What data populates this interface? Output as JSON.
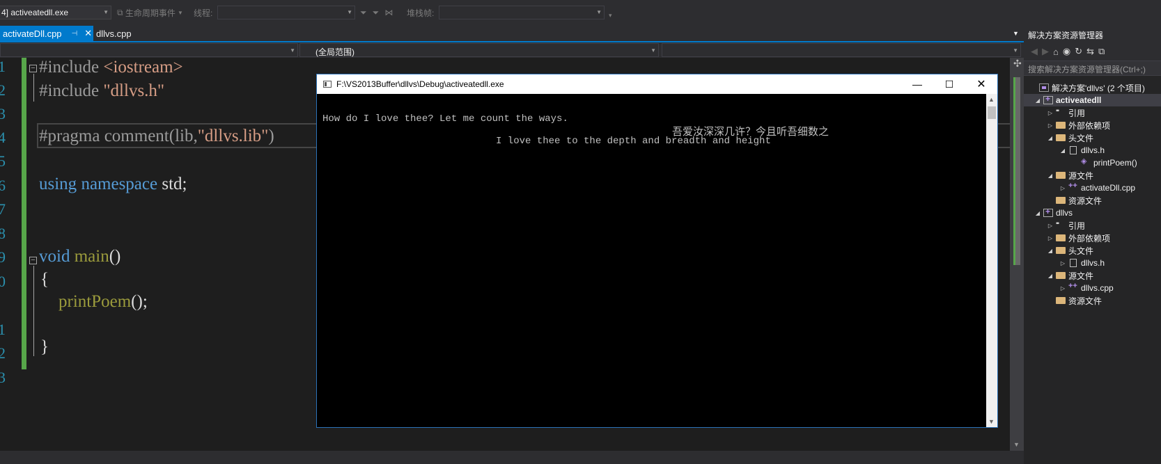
{
  "colors": {
    "accent": "#007acc",
    "editor_bg": "#1e1e1e",
    "keyword": "#569cd6",
    "string": "#d69d85",
    "preprocessor": "#9b9b9b",
    "function": "#9b9b3c",
    "change_marker": "#57a64a",
    "console_bg": "#000000"
  },
  "toolbar": {
    "process_value": "4] activeatedll.exe",
    "lifecycle_label": "生命周期事件",
    "thread_label": "线程:",
    "thread_value": "",
    "stack_label": "堆栈帧:",
    "stack_value": ""
  },
  "tabs": [
    {
      "label": "activateDll.cpp",
      "active": true
    },
    {
      "label": "dllvs.cpp",
      "active": false
    }
  ],
  "navbar": {
    "project_combo": "",
    "scope_combo": "(全局范围)",
    "member_combo": ""
  },
  "editor": {
    "line_numbers": [
      "1",
      "2",
      "3",
      "4",
      "5",
      "6",
      "7",
      "8",
      "9",
      "0",
      "1",
      "2",
      "3"
    ],
    "lines": {
      "l1_pp": "#include ",
      "l1_str": "<iostream>",
      "l2_pp": "#include ",
      "l2_str": "\"dllvs.h\"",
      "l4_pp": "#pragma comment(lib,",
      "l4_str": "\"dllvs.lib\"",
      "l4_end": ")",
      "l6_kw1": "using",
      "l6_kw2": "namespace",
      "l6_rest": " std;",
      "l9_kw": "void",
      "l9_fn": "main",
      "l9_rest": "()",
      "l10": "{",
      "l11_fn": "printPoem",
      "l11_rest": "();",
      "l13": "}"
    }
  },
  "console": {
    "title": "F:\\VS2013Buffer\\dllvs\\Debug\\activeatedll.exe",
    "line1": "How do I love thee? Let me count the ways.",
    "line_cjk": "吾爱汝深深几许？今且听吾细数之",
    "line2": "I love thee to the depth and breadth and height",
    "minimize_icon": "minimize-icon",
    "maximize_icon": "maximize-icon",
    "close_icon": "close-icon"
  },
  "solution_explorer": {
    "title": "解决方案资源管理器",
    "search_placeholder": "搜索解决方案资源管理器(Ctrl+;)",
    "tree": [
      {
        "label": "解决方案'dllvs' (2 个项目)",
        "icon": "solution-icon",
        "arrow": ""
      },
      {
        "label": "activeatedll",
        "icon": "project-icon",
        "arrow": "◢",
        "bold": true
      },
      {
        "label": "引用",
        "icon": "references-icon",
        "arrow": "▷"
      },
      {
        "label": "外部依赖项",
        "icon": "folder-icon",
        "arrow": "▷"
      },
      {
        "label": "头文件",
        "icon": "folder-icon",
        "arrow": "◢"
      },
      {
        "label": "dllvs.h",
        "icon": "header-file-icon",
        "arrow": "◢"
      },
      {
        "label": "printPoem()",
        "icon": "method-icon",
        "arrow": ""
      },
      {
        "label": "源文件",
        "icon": "folder-icon",
        "arrow": "◢"
      },
      {
        "label": "activateDll.cpp",
        "icon": "cpp-file-icon",
        "arrow": "▷"
      },
      {
        "label": "资源文件",
        "icon": "folder-icon",
        "arrow": ""
      },
      {
        "label": "dllvs",
        "icon": "project-icon",
        "arrow": "◢"
      },
      {
        "label": "引用",
        "icon": "references-icon",
        "arrow": "▷"
      },
      {
        "label": "外部依赖项",
        "icon": "folder-icon",
        "arrow": "▷"
      },
      {
        "label": "头文件",
        "icon": "folder-icon",
        "arrow": "◢"
      },
      {
        "label": "dllvs.h",
        "icon": "header-file-icon",
        "arrow": "▷"
      },
      {
        "label": "源文件",
        "icon": "folder-icon",
        "arrow": "◢"
      },
      {
        "label": "dllvs.cpp",
        "icon": "cpp-file-icon",
        "arrow": "▷"
      },
      {
        "label": "资源文件",
        "icon": "folder-icon",
        "arrow": ""
      }
    ]
  }
}
